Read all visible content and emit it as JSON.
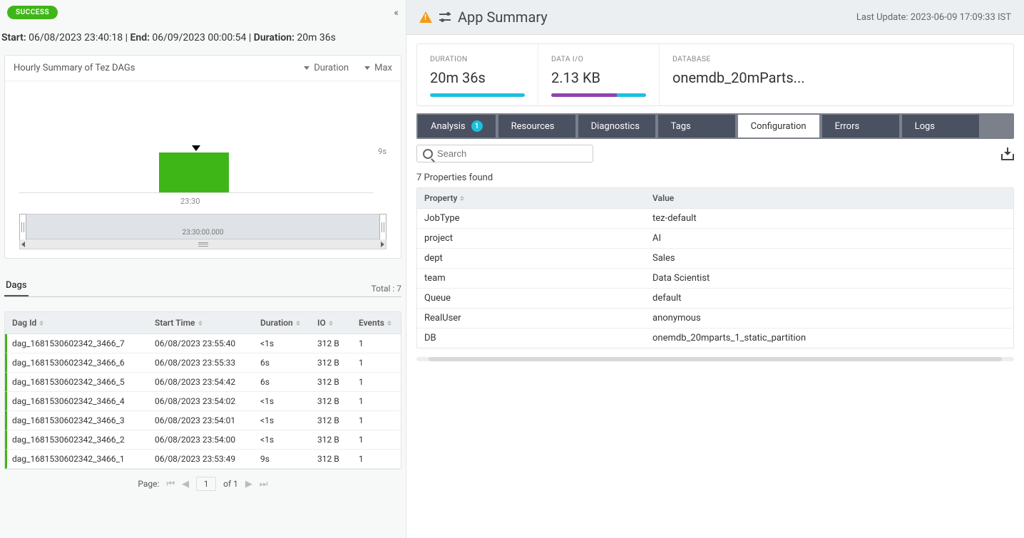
{
  "left": {
    "status_badge": "SUCCESS",
    "start_label": "Start:",
    "start_value": "06/08/2023 23:40:18",
    "end_label": "End:",
    "end_value": "06/09/2023 00:00:54",
    "duration_label": "Duration:",
    "duration_value": "20m 36s"
  },
  "chart": {
    "title": "Hourly Summary of Tez DAGs",
    "dd1": "Duration",
    "dd2": "Max",
    "x_label": "23:30",
    "y_label": "9s",
    "scrub_time": "23:30:00.000"
  },
  "chart_data": {
    "type": "bar",
    "categories": [
      "23:30"
    ],
    "values": [
      9
    ],
    "title": "Hourly Summary of Tez DAGs",
    "xlabel": "",
    "ylabel": "",
    "ylim": [
      0,
      9
    ],
    "unit": "s"
  },
  "dags": {
    "tab_label": "Dags",
    "total_label": "Total : 7",
    "headers": {
      "id": "Dag Id",
      "start": "Start Time",
      "dur": "Duration",
      "io": "IO",
      "ev": "Events"
    },
    "rows": [
      {
        "id": "dag_1681530602342_3466_7",
        "start": "06/08/2023 23:55:40",
        "dur": "<1s",
        "io": "312 B",
        "ev": "1"
      },
      {
        "id": "dag_1681530602342_3466_6",
        "start": "06/08/2023 23:55:33",
        "dur": "6s",
        "io": "312 B",
        "ev": "1"
      },
      {
        "id": "dag_1681530602342_3466_5",
        "start": "06/08/2023 23:54:42",
        "dur": "6s",
        "io": "312 B",
        "ev": "1"
      },
      {
        "id": "dag_1681530602342_3466_4",
        "start": "06/08/2023 23:54:02",
        "dur": "<1s",
        "io": "312 B",
        "ev": "1"
      },
      {
        "id": "dag_1681530602342_3466_3",
        "start": "06/08/2023 23:54:01",
        "dur": "<1s",
        "io": "312 B",
        "ev": "1"
      },
      {
        "id": "dag_1681530602342_3466_2",
        "start": "06/08/2023 23:54:00",
        "dur": "<1s",
        "io": "312 B",
        "ev": "1"
      },
      {
        "id": "dag_1681530602342_3466_1",
        "start": "06/08/2023 23:53:49",
        "dur": "9s",
        "io": "312 B",
        "ev": "1"
      }
    ],
    "pager": {
      "label": "Page:",
      "current": "1",
      "of_label": "of 1"
    }
  },
  "right": {
    "title": "App Summary",
    "last_update_label": "Last Update: 2023-06-09 17:09:33 IST",
    "metrics": [
      {
        "label": "DURATION",
        "value": "20m 36s",
        "cyan": 100,
        "purple": 0
      },
      {
        "label": "DATA I/O",
        "value": "2.13 KB",
        "cyan": 31,
        "purple": 69
      },
      {
        "label": "DATABASE",
        "value": "onemdb_20mParts...",
        "cyan": 0,
        "purple": 0
      }
    ],
    "tabs": [
      {
        "label": "Analysis",
        "badge": "1"
      },
      {
        "label": "Resources"
      },
      {
        "label": "Diagnostics"
      },
      {
        "label": "Tags"
      },
      {
        "label": "Configuration",
        "active": true
      },
      {
        "label": "Errors"
      },
      {
        "label": "Logs"
      }
    ],
    "search_placeholder": "Search",
    "props_found": "7 Properties found",
    "props_headers": {
      "prop": "Property",
      "val": "Value"
    },
    "props": [
      {
        "prop": "JobType",
        "val": "tez-default"
      },
      {
        "prop": "project",
        "val": "AI"
      },
      {
        "prop": "dept",
        "val": "Sales"
      },
      {
        "prop": "team",
        "val": "Data Scientist"
      },
      {
        "prop": "Queue",
        "val": "default"
      },
      {
        "prop": "RealUser",
        "val": "anonymous"
      },
      {
        "prop": "DB",
        "val": "onemdb_20mparts_1_static_partition"
      }
    ]
  }
}
